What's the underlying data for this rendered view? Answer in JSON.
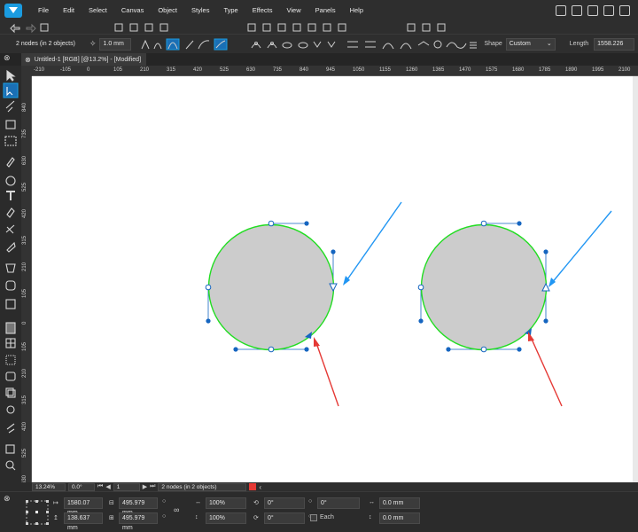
{
  "menu": {
    "items": [
      "File",
      "Edit",
      "Select",
      "Canvas",
      "Object",
      "Styles",
      "Type",
      "Effects",
      "View",
      "Panels",
      "Help"
    ]
  },
  "context_toolbar": {
    "selection_info": "2 nodes (in 2 objects)",
    "stroke_width": "1.0 mm",
    "shape_label": "Shape",
    "shape_value": "Custom",
    "length_label": "Length",
    "length_value": "1558.226"
  },
  "document_tab": {
    "title": "Untitled-1 [RGB] [@13.2%] - [Modified]"
  },
  "rulers": {
    "horizontal": [
      "-210",
      "-105",
      "0",
      "105",
      "210",
      "315",
      "420",
      "525",
      "630",
      "735",
      "840",
      "945",
      "1050",
      "1155",
      "1260",
      "1365",
      "1470",
      "1575",
      "1680",
      "1785",
      "1890",
      "1995",
      "2100"
    ],
    "vertical": [
      "840",
      "735",
      "630",
      "525",
      "420",
      "315",
      "210",
      "105",
      "0",
      "105",
      "210",
      "315",
      "420",
      "525",
      "630"
    ]
  },
  "status_bar": {
    "zoom": "13.24%",
    "angle": "0.0°",
    "page": "1",
    "selection": "2 nodes (in 2 objects)"
  },
  "transform": {
    "x": "1580.07 mm",
    "y": "138.637 mm",
    "width": "495.979 mm",
    "height": "495.979 mm",
    "scale_w": "100%",
    "scale_h": "100%",
    "rotate": "0°",
    "shear": "0°",
    "skew": "0°",
    "each_label": "Each",
    "spacing_h": "0.0 mm",
    "spacing_v": "0.0 mm"
  },
  "colors": {
    "accent": "#1a9be0",
    "canvas": "#ffffff",
    "shape_fill": "#cccccc",
    "shape_stroke": "#22dd22",
    "node": "#1565c0",
    "blue_arrow": "#2196f3",
    "red_arrow": "#e53935"
  }
}
